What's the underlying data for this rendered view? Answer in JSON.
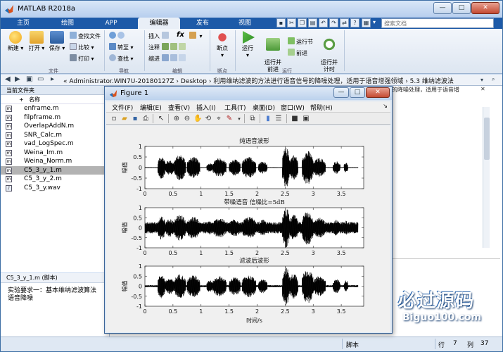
{
  "window": {
    "title": "MATLAB R2018a",
    "min_glyph": "—",
    "max_glyph": "□",
    "close_glyph": "✕"
  },
  "ribbon_tabs": [
    {
      "label": "主页"
    },
    {
      "label": "绘图"
    },
    {
      "label": "APP"
    },
    {
      "label": "编辑器"
    },
    {
      "label": "发布"
    },
    {
      "label": "视图"
    }
  ],
  "active_tab": "编辑器",
  "search": {
    "placeholder": "搜索文档"
  },
  "ribbon": {
    "file_group": {
      "label": "文件",
      "new": "新建",
      "open": "打开",
      "save": "保存",
      "find_files": "查找文件",
      "compare": "比较",
      "print": "打印"
    },
    "nav_group": {
      "label": "导航",
      "goto": "转至",
      "find": "查找"
    },
    "edit_group": {
      "label": "编辑",
      "insert": "插入",
      "comment": "注释",
      "indent": "缩进",
      "fx": "fx"
    },
    "breakpoint_group": {
      "label": "断点",
      "breakpoints": "断点"
    },
    "run_group": {
      "label": "运行",
      "run": "运行",
      "run_and_advance": "运行并\n前进",
      "run_section": "运行节",
      "advance": "前进",
      "run_and_time": "运行并\n计时"
    }
  },
  "address": {
    "path": "« Administrator.WIN7U-20180127Z  ›  Desktop  ›  利用维纳滤波的方法进行语音信号的降噪处理，适用于语音增强领域  ›  5.3 维纳滤波法"
  },
  "current_folder": {
    "title": "当前文件夹",
    "column": "名称",
    "files": [
      {
        "name": "enframe.m",
        "selected": false
      },
      {
        "name": "filpframe.m",
        "selected": false
      },
      {
        "name": "OverlapAddN.m",
        "selected": false
      },
      {
        "name": "SNR_Calc.m",
        "selected": false
      },
      {
        "name": "vad_LogSpec.m",
        "selected": false
      },
      {
        "name": "Weina_Im.m",
        "selected": false
      },
      {
        "name": "Weina_Norm.m",
        "selected": false
      },
      {
        "name": "C5_3_y_1.m",
        "selected": true
      },
      {
        "name": "C5_3_y_2.m",
        "selected": false
      },
      {
        "name": "C5_3_y.wav",
        "selected": false
      }
    ]
  },
  "detail": {
    "header": "C5_3_y_1.m  (脚本)",
    "text": "实验要求一：基本维纳滤波算法语音降噪"
  },
  "editor_tab": "的降噪处理，适用于语音增",
  "status": {
    "type": "脚本",
    "row_label": "行",
    "row": "7",
    "col_label": "列",
    "col": "37"
  },
  "watermark": {
    "title": "必过源码",
    "url": "Biguo100.com"
  },
  "figure": {
    "title": "Figure 1",
    "menus": [
      "文件(F)",
      "编辑(E)",
      "查看(V)",
      "插入(I)",
      "工具(T)",
      "桌面(D)",
      "窗口(W)",
      "帮助(H)"
    ],
    "toolbar_icons": [
      "new-figure-icon",
      "open-icon",
      "save-icon",
      "print-icon",
      "pointer-icon",
      "zoom-in-icon",
      "zoom-out-icon",
      "pan-icon",
      "rotate-icon",
      "data-cursor-icon",
      "brush-icon",
      "link-icon",
      "colorbar-icon",
      "legend-icon",
      "hide-plot-tools-icon",
      "show-plot-tools-icon"
    ]
  },
  "chart_data": [
    {
      "type": "line",
      "title": "纯语音波形",
      "ylabel": "幅值",
      "xlabel": "",
      "xlim": [
        0,
        3.9
      ],
      "ylim": [
        -1,
        1
      ],
      "xticks": [
        0,
        0.5,
        1,
        1.5,
        2,
        2.5,
        3,
        3.5
      ],
      "yticks": [
        -1,
        -0.5,
        0,
        0.5,
        1
      ],
      "segments": [
        {
          "start": 0.23,
          "end": 0.36,
          "amp": 0.55
        },
        {
          "start": 0.36,
          "end": 0.52,
          "amp": 0.35
        },
        {
          "start": 0.52,
          "end": 0.73,
          "amp": 0.6
        },
        {
          "start": 0.75,
          "end": 0.98,
          "amp": 0.5
        },
        {
          "start": 1.1,
          "end": 1.21,
          "amp": 0.2
        },
        {
          "start": 1.21,
          "end": 1.45,
          "amp": 0.45
        },
        {
          "start": 1.5,
          "end": 1.7,
          "amp": 0.38
        },
        {
          "start": 1.73,
          "end": 1.98,
          "amp": 0.5
        },
        {
          "start": 2.02,
          "end": 2.18,
          "amp": 0.3
        },
        {
          "start": 2.45,
          "end": 2.58,
          "amp": 0.95
        },
        {
          "start": 2.58,
          "end": 2.73,
          "amp": 0.6
        },
        {
          "start": 2.8,
          "end": 3.0,
          "amp": 0.8
        },
        {
          "start": 3.0,
          "end": 3.22,
          "amp": 0.45
        },
        {
          "start": 3.35,
          "end": 3.48,
          "amp": 0.3
        },
        {
          "start": 3.55,
          "end": 3.62,
          "amp": 0.25
        }
      ],
      "noise_floor": 0.02
    },
    {
      "type": "line",
      "title": "带噪语音 信噪比=5dB",
      "ylabel": "幅值",
      "xlabel": "",
      "xlim": [
        0,
        3.9
      ],
      "ylim": [
        -1,
        1
      ],
      "xticks": [
        0,
        0.5,
        1,
        1.5,
        2,
        2.5,
        3,
        3.5
      ],
      "yticks": [
        -1,
        -0.5,
        0,
        0.5,
        1
      ],
      "segments": [
        {
          "start": 0.23,
          "end": 0.36,
          "amp": 0.6
        },
        {
          "start": 0.36,
          "end": 0.52,
          "amp": 0.45
        },
        {
          "start": 0.52,
          "end": 0.73,
          "amp": 0.65
        },
        {
          "start": 0.75,
          "end": 0.98,
          "amp": 0.55
        },
        {
          "start": 1.1,
          "end": 1.21,
          "amp": 0.35
        },
        {
          "start": 1.21,
          "end": 1.45,
          "amp": 0.5
        },
        {
          "start": 1.5,
          "end": 1.7,
          "amp": 0.45
        },
        {
          "start": 1.73,
          "end": 1.98,
          "amp": 0.55
        },
        {
          "start": 2.02,
          "end": 2.18,
          "amp": 0.4
        },
        {
          "start": 2.45,
          "end": 2.58,
          "amp": 1.0
        },
        {
          "start": 2.58,
          "end": 2.73,
          "amp": 0.65
        },
        {
          "start": 2.8,
          "end": 3.0,
          "amp": 0.85
        },
        {
          "start": 3.0,
          "end": 3.22,
          "amp": 0.5
        },
        {
          "start": 3.35,
          "end": 3.48,
          "amp": 0.4
        },
        {
          "start": 3.55,
          "end": 3.62,
          "amp": 0.35
        }
      ],
      "noise_floor": 0.28
    },
    {
      "type": "line",
      "title": "滤波后波形",
      "ylabel": "幅值",
      "xlabel": "时间/s",
      "xlim": [
        0,
        3.9
      ],
      "ylim": [
        -1,
        1
      ],
      "xticks": [
        0,
        0.5,
        1,
        1.5,
        2,
        2.5,
        3,
        3.5
      ],
      "yticks": [
        -1,
        -0.5,
        0,
        0.5,
        1
      ],
      "segments": [
        {
          "start": 0.23,
          "end": 0.36,
          "amp": 0.6
        },
        {
          "start": 0.36,
          "end": 0.52,
          "amp": 0.4
        },
        {
          "start": 0.52,
          "end": 0.73,
          "amp": 0.6
        },
        {
          "start": 0.75,
          "end": 0.98,
          "amp": 0.55
        },
        {
          "start": 1.1,
          "end": 1.21,
          "amp": 0.3
        },
        {
          "start": 1.21,
          "end": 1.45,
          "amp": 0.5
        },
        {
          "start": 1.5,
          "end": 1.7,
          "amp": 0.45
        },
        {
          "start": 1.73,
          "end": 1.98,
          "amp": 0.55
        },
        {
          "start": 2.02,
          "end": 2.18,
          "amp": 0.35
        },
        {
          "start": 2.45,
          "end": 2.58,
          "amp": 0.95
        },
        {
          "start": 2.58,
          "end": 2.73,
          "amp": 0.65
        },
        {
          "start": 2.8,
          "end": 3.0,
          "amp": 0.85
        },
        {
          "start": 3.0,
          "end": 3.22,
          "amp": 0.5
        },
        {
          "start": 3.35,
          "end": 3.48,
          "amp": 0.35
        },
        {
          "start": 3.55,
          "end": 3.62,
          "amp": 0.3
        }
      ],
      "noise_floor": 0.05
    }
  ]
}
